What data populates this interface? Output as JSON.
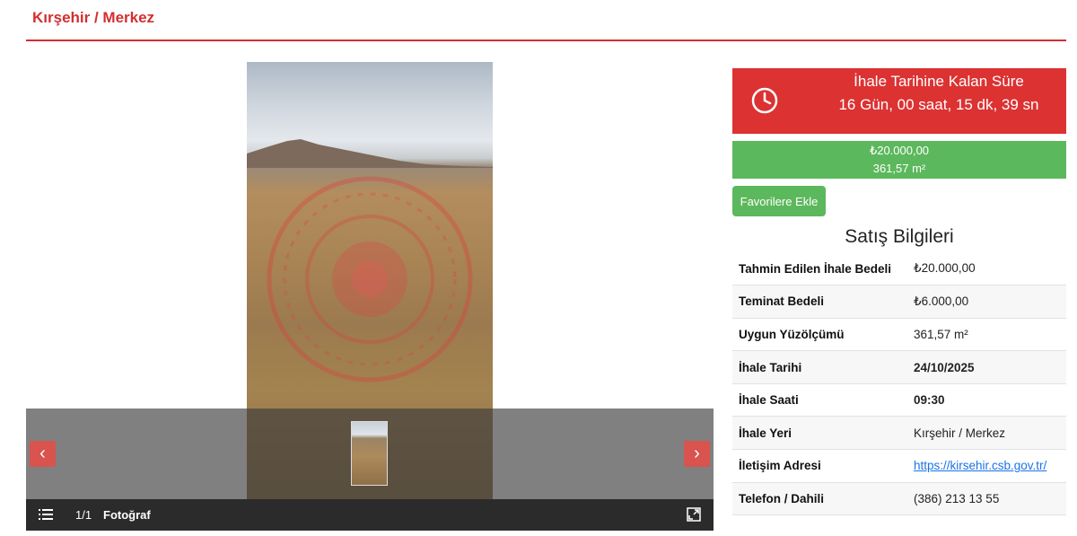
{
  "header": {
    "title": "Kırşehir / Merkez"
  },
  "gallery": {
    "counter": "1/1",
    "caption": "Fotoğraf",
    "prev_label": "‹",
    "next_label": "›"
  },
  "countdown": {
    "title": "İhale Tarihine Kalan Süre",
    "value": "16 Gün, 00 saat, 15 dk, 39 sn"
  },
  "price": {
    "amount": "₺20.000,00",
    "area": "361,57 m²"
  },
  "favorites_button": "Favorilere Ekle",
  "sales_info": {
    "title": "Satış Bilgileri",
    "rows": [
      {
        "label": "Tahmin Edilen İhale Bedeli",
        "value": "₺20.000,00"
      },
      {
        "label": "Teminat Bedeli",
        "value": "₺6.000,00"
      },
      {
        "label": "Uygun Yüzölçümü",
        "value": "361,57 m²"
      },
      {
        "label": "İhale Tarihi",
        "value": "24/10/2025"
      },
      {
        "label": "İhale Saati",
        "value": "09:30"
      },
      {
        "label": "İhale Yeri",
        "value": "Kırşehir / Merkez"
      },
      {
        "label": "İletişim Adresi",
        "value": "https://kirsehir.csb.gov.tr/"
      },
      {
        "label": "Telefon / Dahili",
        "value": "(386) 213 13 55"
      }
    ]
  },
  "colors": {
    "accent_red": "#dc3232",
    "success_green": "#5cb85c",
    "link_blue": "#1a73e8"
  },
  "icons": [
    "clock-icon",
    "list-icon",
    "fullscreen-icon",
    "chevron-left-icon",
    "chevron-right-icon"
  ]
}
